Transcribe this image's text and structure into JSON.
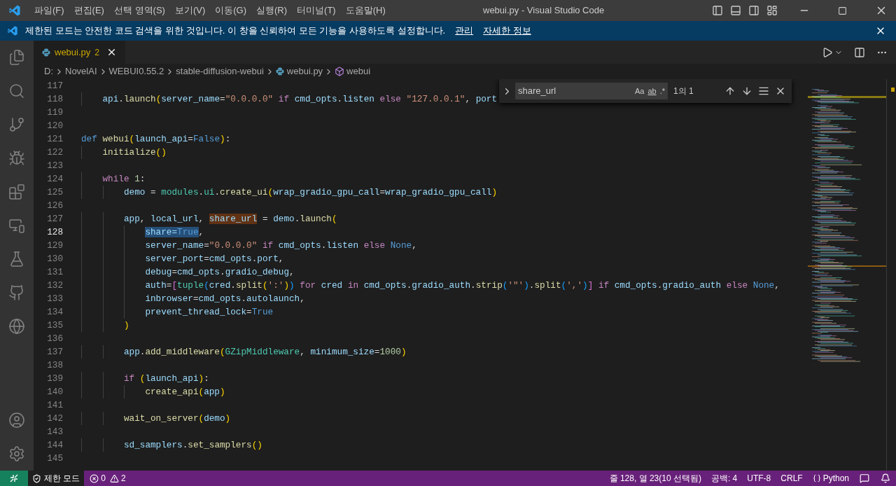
{
  "menu": [
    "파일(F)",
    "편집(E)",
    "선택 영역(S)",
    "보기(V)",
    "이동(G)",
    "실행(R)",
    "터미널(T)",
    "도움말(H)"
  ],
  "window": {
    "title": "webui.py - Visual Studio Code"
  },
  "banner": {
    "message": "제한된 모드는 안전한 코드 검색을 위한 것입니다. 이 창을 신뢰하여 모든 기능을 사용하도록 설정합니다.",
    "links": [
      "관리",
      "자세한 정보"
    ]
  },
  "tabs": [
    {
      "label": "webui.py",
      "badge": "2",
      "selected": true
    }
  ],
  "breadcrumb": [
    "D:",
    "NovelAI",
    "WEBUI0.55.2",
    "stable-diffusion-webui",
    "webui.py",
    "webui"
  ],
  "find": {
    "value": "share_url",
    "options": [
      "Aa",
      "ab",
      ".*"
    ],
    "result": "1의 1"
  },
  "editor": {
    "lines": [
      {
        "n": "117",
        "current": false
      },
      {
        "n": "118",
        "current": false,
        "tokens": [
          {
            "t": "    api",
            "kind": "var"
          },
          {
            "t": ".",
            "kind": "plain"
          },
          {
            "t": "launch",
            "kind": "func"
          },
          {
            "t": "(",
            "kind": "b1"
          },
          {
            "t": "server_name",
            "kind": "var"
          },
          {
            "t": "=",
            "kind": "plain"
          },
          {
            "t": "\"0.0.0.0\"",
            "kind": "string"
          },
          {
            "t": " if",
            "kind": "control"
          },
          {
            "t": " cmd_opts",
            "kind": "var"
          },
          {
            "t": ".",
            "kind": "plain"
          },
          {
            "t": "listen",
            "kind": "var"
          },
          {
            "t": " else",
            "kind": "control"
          },
          {
            "t": " \"127.0.0.1\"",
            "kind": "string"
          },
          {
            "t": ",",
            "kind": "plain"
          },
          {
            "t": " port",
            "kind": "var"
          }
        ]
      },
      {
        "n": "119",
        "current": false
      },
      {
        "n": "120",
        "current": false
      },
      {
        "n": "121",
        "current": false,
        "tokens": [
          {
            "t": "def",
            "kind": "keyword"
          },
          {
            "t": " webui",
            "kind": "func"
          },
          {
            "t": "(",
            "kind": "b1"
          },
          {
            "t": "launch_api",
            "kind": "var"
          },
          {
            "t": "=",
            "kind": "plain"
          },
          {
            "t": "False",
            "kind": "const"
          },
          {
            "t": ")",
            "kind": "b1"
          },
          {
            "t": ":",
            "kind": "plain"
          }
        ]
      },
      {
        "n": "122",
        "current": false,
        "tokens": [
          {
            "t": "    initialize",
            "kind": "func"
          },
          {
            "t": "()",
            "kind": "b1"
          }
        ]
      },
      {
        "n": "123",
        "current": false
      },
      {
        "n": "124",
        "current": false,
        "tokens": [
          {
            "t": "    while",
            "kind": "control"
          },
          {
            "t": " 1",
            "kind": "number"
          },
          {
            "t": ":",
            "kind": "plain"
          }
        ]
      },
      {
        "n": "125",
        "current": false,
        "tokens": [
          {
            "t": "        demo",
            "kind": "var"
          },
          {
            "t": " =",
            "kind": "plain"
          },
          {
            "t": " modules",
            "kind": "class"
          },
          {
            "t": ".",
            "kind": "plain"
          },
          {
            "t": "ui",
            "kind": "class"
          },
          {
            "t": ".",
            "kind": "plain"
          },
          {
            "t": "create_ui",
            "kind": "func"
          },
          {
            "t": "(",
            "kind": "b1"
          },
          {
            "t": "wrap_gradio_gpu_call",
            "kind": "var"
          },
          {
            "t": "=",
            "kind": "plain"
          },
          {
            "t": "wrap_gradio_gpu_call",
            "kind": "var"
          },
          {
            "t": ")",
            "kind": "b1"
          }
        ]
      },
      {
        "n": "126",
        "current": false
      },
      {
        "n": "127",
        "current": false,
        "tokens": [
          {
            "t": "        app",
            "kind": "var"
          },
          {
            "t": ",",
            "kind": "plain"
          },
          {
            "t": " local_url",
            "kind": "var"
          },
          {
            "t": ", ",
            "kind": "plain"
          },
          {
            "t": "share_url",
            "kind": "var",
            "found": true
          },
          {
            "t": " =",
            "kind": "plain"
          },
          {
            "t": " demo",
            "kind": "var"
          },
          {
            "t": ".",
            "kind": "plain"
          },
          {
            "t": "launch",
            "kind": "func"
          },
          {
            "t": "(",
            "kind": "b1"
          }
        ]
      },
      {
        "n": "128",
        "current": true,
        "tokens": [
          {
            "t": "            share=",
            "kind": "var",
            "selected": true
          },
          {
            "t": "True",
            "kind": "const",
            "selected": true
          },
          {
            "t": ",",
            "kind": "plain"
          }
        ]
      },
      {
        "n": "129",
        "current": false,
        "tokens": [
          {
            "t": "            server_name",
            "kind": "var"
          },
          {
            "t": "=",
            "kind": "plain"
          },
          {
            "t": "\"0.0.0.0\"",
            "kind": "string"
          },
          {
            "t": " if",
            "kind": "control"
          },
          {
            "t": " cmd_opts",
            "kind": "var"
          },
          {
            "t": ".",
            "kind": "plain"
          },
          {
            "t": "listen",
            "kind": "var"
          },
          {
            "t": " else",
            "kind": "control"
          },
          {
            "t": " None",
            "kind": "const"
          },
          {
            "t": ",",
            "kind": "plain"
          }
        ]
      },
      {
        "n": "130",
        "current": false,
        "tokens": [
          {
            "t": "            server_port",
            "kind": "var"
          },
          {
            "t": "=",
            "kind": "plain"
          },
          {
            "t": "cmd_opts",
            "kind": "var"
          },
          {
            "t": ".",
            "kind": "plain"
          },
          {
            "t": "port",
            "kind": "var"
          },
          {
            "t": ",",
            "kind": "plain"
          }
        ]
      },
      {
        "n": "131",
        "current": false,
        "tokens": [
          {
            "t": "            debug",
            "kind": "var"
          },
          {
            "t": "=",
            "kind": "plain"
          },
          {
            "t": "cmd_opts",
            "kind": "var"
          },
          {
            "t": ".",
            "kind": "plain"
          },
          {
            "t": "gradio_debug",
            "kind": "var"
          },
          {
            "t": ",",
            "kind": "plain"
          }
        ]
      },
      {
        "n": "132",
        "current": false,
        "tokens": [
          {
            "t": "            auth",
            "kind": "var"
          },
          {
            "t": "=",
            "kind": "plain"
          },
          {
            "t": "[",
            "kind": "b2"
          },
          {
            "t": "tuple",
            "kind": "class"
          },
          {
            "t": "(",
            "kind": "b3"
          },
          {
            "t": "cred",
            "kind": "var"
          },
          {
            "t": ".",
            "kind": "plain"
          },
          {
            "t": "split",
            "kind": "func"
          },
          {
            "t": "(",
            "kind": "b1"
          },
          {
            "t": "':'",
            "kind": "string"
          },
          {
            "t": ")",
            "kind": "b1"
          },
          {
            "t": ")",
            "kind": "b3"
          },
          {
            "t": " for",
            "kind": "control"
          },
          {
            "t": " cred",
            "kind": "var"
          },
          {
            "t": " in",
            "kind": "control"
          },
          {
            "t": " cmd_opts",
            "kind": "var"
          },
          {
            "t": ".",
            "kind": "plain"
          },
          {
            "t": "gradio_auth",
            "kind": "var"
          },
          {
            "t": ".",
            "kind": "plain"
          },
          {
            "t": "strip",
            "kind": "func"
          },
          {
            "t": "(",
            "kind": "b3"
          },
          {
            "t": "'\"'",
            "kind": "string"
          },
          {
            "t": ")",
            "kind": "b3"
          },
          {
            "t": ".",
            "kind": "plain"
          },
          {
            "t": "split",
            "kind": "func"
          },
          {
            "t": "(",
            "kind": "b3"
          },
          {
            "t": "','",
            "kind": "string"
          },
          {
            "t": ")",
            "kind": "b3"
          },
          {
            "t": "]",
            "kind": "b2"
          },
          {
            "t": " if",
            "kind": "control"
          },
          {
            "t": " cmd_opts",
            "kind": "var"
          },
          {
            "t": ".",
            "kind": "plain"
          },
          {
            "t": "gradio_auth",
            "kind": "var"
          },
          {
            "t": " else",
            "kind": "control"
          },
          {
            "t": " None",
            "kind": "const"
          },
          {
            "t": ",",
            "kind": "plain"
          }
        ]
      },
      {
        "n": "133",
        "current": false,
        "tokens": [
          {
            "t": "            inbrowser",
            "kind": "var"
          },
          {
            "t": "=",
            "kind": "plain"
          },
          {
            "t": "cmd_opts",
            "kind": "var"
          },
          {
            "t": ".",
            "kind": "plain"
          },
          {
            "t": "autolaunch",
            "kind": "var"
          },
          {
            "t": ",",
            "kind": "plain"
          }
        ]
      },
      {
        "n": "134",
        "current": false,
        "tokens": [
          {
            "t": "            prevent_thread_lock",
            "kind": "var"
          },
          {
            "t": "=",
            "kind": "plain"
          },
          {
            "t": "True",
            "kind": "const"
          }
        ]
      },
      {
        "n": "135",
        "current": false,
        "tokens": [
          {
            "t": "        )",
            "kind": "b1"
          }
        ]
      },
      {
        "n": "136",
        "current": false
      },
      {
        "n": "137",
        "current": false,
        "tokens": [
          {
            "t": "        app",
            "kind": "var"
          },
          {
            "t": ".",
            "kind": "plain"
          },
          {
            "t": "add_middleware",
            "kind": "func"
          },
          {
            "t": "(",
            "kind": "b1"
          },
          {
            "t": "GZipMiddleware",
            "kind": "class"
          },
          {
            "t": ",",
            "kind": "plain"
          },
          {
            "t": " minimum_size",
            "kind": "var"
          },
          {
            "t": "=",
            "kind": "plain"
          },
          {
            "t": "1000",
            "kind": "number"
          },
          {
            "t": ")",
            "kind": "b1"
          }
        ]
      },
      {
        "n": "138",
        "current": false
      },
      {
        "n": "139",
        "current": false,
        "tokens": [
          {
            "t": "        if",
            "kind": "control"
          },
          {
            "t": " (",
            "kind": "b1"
          },
          {
            "t": "launch_api",
            "kind": "var"
          },
          {
            "t": ")",
            "kind": "b1"
          },
          {
            "t": ":",
            "kind": "plain"
          }
        ]
      },
      {
        "n": "140",
        "current": false,
        "tokens": [
          {
            "t": "            create_api",
            "kind": "func"
          },
          {
            "t": "(",
            "kind": "b1"
          },
          {
            "t": "app",
            "kind": "var"
          },
          {
            "t": ")",
            "kind": "b1"
          }
        ]
      },
      {
        "n": "141",
        "current": false
      },
      {
        "n": "142",
        "current": false,
        "tokens": [
          {
            "t": "        wait_on_server",
            "kind": "func"
          },
          {
            "t": "(",
            "kind": "b1"
          },
          {
            "t": "demo",
            "kind": "var"
          },
          {
            "t": ")",
            "kind": "b1"
          }
        ]
      },
      {
        "n": "143",
        "current": false
      },
      {
        "n": "144",
        "current": false,
        "tokens": [
          {
            "t": "        sd_samplers",
            "kind": "var"
          },
          {
            "t": ".",
            "kind": "plain"
          },
          {
            "t": "set_samplers",
            "kind": "func"
          },
          {
            "t": "()",
            "kind": "b1"
          }
        ]
      },
      {
        "n": "145",
        "current": false
      }
    ]
  },
  "status_bar": {
    "mode": "제한 모드",
    "errors": "0",
    "warnings": "2",
    "right": [
      "줄 128, 열 23(10 선택됨)",
      "공백: 4",
      "UTF-8",
      "CRLF",
      "Python"
    ]
  }
}
